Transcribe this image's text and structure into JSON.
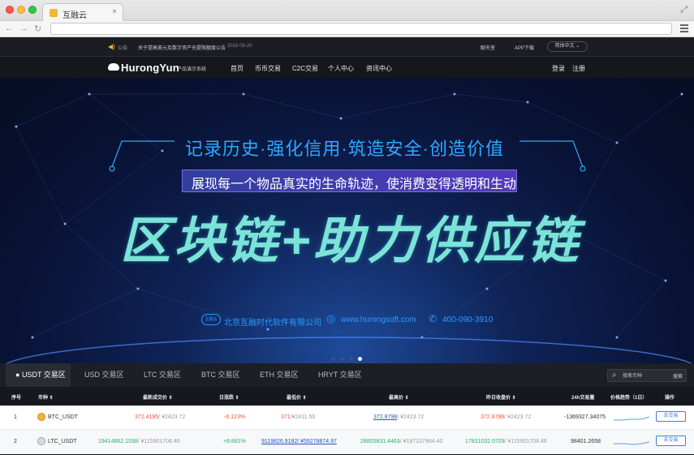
{
  "browser": {
    "tab_title": "互融云",
    "tab_close": "×",
    "expand_glyph": "⤢",
    "nav_back": "←",
    "nav_forward": "→",
    "nav_reload": "↻",
    "url": ""
  },
  "topbar": {
    "notice_icon": "speaker-icon",
    "notice_label": "公告:",
    "notice_text": "关于提高美元及数字资产充提限额度公告",
    "notice_date": "2018-06-20",
    "kefu": "聊天室",
    "app_download": "APP下载",
    "language": "简体中文 ⌄"
  },
  "header": {
    "logo_text": "HurongYun",
    "logo_sub": "产品演示系统",
    "nav": [
      "首页",
      "币币交易",
      "C2C交易",
      "个人中心",
      "资讯中心"
    ],
    "login": "登录",
    "register": "注册"
  },
  "banner": {
    "slogan1": "记录历史·强化信用·筑造安全·创造价值",
    "slogan2": "展现每一个物品真实的生命轨迹，使消费变得透明和生动",
    "headline": "区块链+助力供应链",
    "company_logo": "互融云",
    "company": "北京互融时代软件有限公司",
    "url": "www.hurongsoft.com",
    "phone": "400-090-3910",
    "slides": 4,
    "active_slide": 4
  },
  "market": {
    "tabs": [
      "USDT 交易区",
      "USD 交易区",
      "LTC 交易区",
      "BTC 交易区",
      "ETH 交易区",
      "HRYT 交易区"
    ],
    "active_tab": 0,
    "search_placeholder": "搜索币种",
    "search_button": "搜索"
  },
  "table": {
    "headers": [
      "序号",
      "币种",
      "最新成交价",
      "日涨跌",
      "最低价",
      "最高价",
      "昨日收盘价",
      "24h交易量",
      "价格趋势（1日）",
      "操作"
    ],
    "rows": [
      {
        "index": "1",
        "coin": "BTC_USDT",
        "last_price": "372.4195",
        "last_price_cny": "/ ¥2423.72",
        "change": "-0.123%",
        "low": "371",
        "low_cny": "/¥2411.50",
        "high": "372.8798",
        "high_cny": "/ ¥2423.72",
        "prev_close": "372.8798",
        "prev_close_cny": "/ ¥2423.72",
        "volume": "-1369327.34075",
        "action": "去交易"
      },
      {
        "index": "2",
        "coin": "LTC_USDT",
        "last_price": "19414662.1538",
        "last_price_cny": "/ ¥115901708.46",
        "change": "+8.881%",
        "low": "9119826.9182",
        "low_cny": "/ ¥59278874.97",
        "high": "28805831.4463",
        "high_cny": "/ ¥187237904.40",
        "prev_close": "17831032.0703",
        "prev_close_cny": "/ ¥115901708.46",
        "volume": "98401.2658",
        "action": "去交易"
      }
    ]
  },
  "colors": {
    "up": "#f0523d",
    "down": "#22b36b",
    "accent": "#3d7fd8"
  }
}
